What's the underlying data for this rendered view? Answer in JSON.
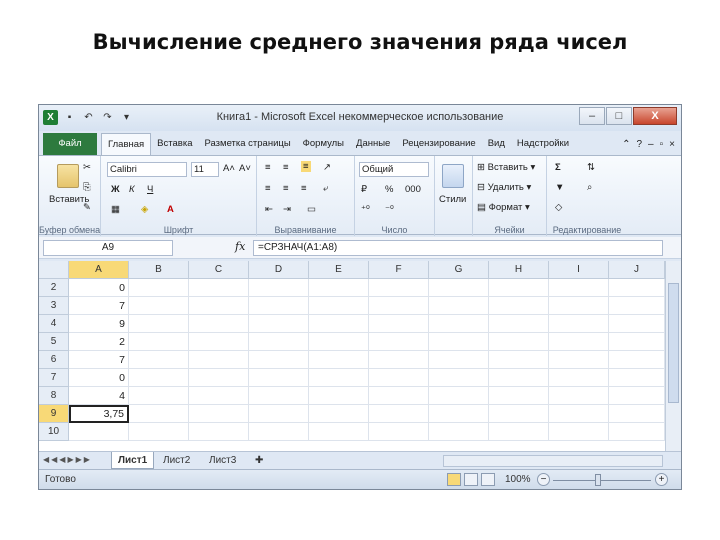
{
  "slide": {
    "title": "Вычисление среднего значения ряда чисел"
  },
  "window": {
    "title": "Книга1 - Microsoft Excel некоммерческое использование",
    "minimize": "–",
    "restore": "□",
    "close": "X"
  },
  "qat": {
    "save": "▪",
    "undo": "↶",
    "redo": "↷",
    "more": "▾"
  },
  "tabs": [
    "Файл",
    "Главная",
    "Вставка",
    "Разметка страницы",
    "Формулы",
    "Данные",
    "Рецензирование",
    "Вид",
    "Надстройки"
  ],
  "ribbon": {
    "clipboard": {
      "paste": "Вставить",
      "label": "Буфер обмена"
    },
    "font": {
      "name": "Calibri",
      "size": "11",
      "bold": "Ж",
      "italic": "К",
      "underline": "Ч",
      "grow": "A˄",
      "shrink": "A˅",
      "label": "Шрифт"
    },
    "alignment": {
      "label": "Выравнивание"
    },
    "number": {
      "format": "Общий",
      "percent": "%",
      "thousands": "000",
      "label": "Число"
    },
    "styles": {
      "button": "Стили",
      "label": ""
    },
    "cells": {
      "insert": "Вставить",
      "delete": "Удалить",
      "format": "Формат",
      "label": "Ячейки"
    },
    "editing": {
      "sum": "Σ",
      "label": "Редактирование"
    }
  },
  "formula_bar": {
    "namebox": "A9",
    "fx": "fx",
    "formula": "=СРЗНАЧ(A1:A8)"
  },
  "grid": {
    "columns": [
      "A",
      "B",
      "C",
      "D",
      "E",
      "F",
      "G",
      "H",
      "I",
      "J"
    ],
    "rows": [
      "2",
      "3",
      "4",
      "5",
      "6",
      "7",
      "8",
      "9",
      "10"
    ],
    "colA_values": [
      "0",
      "7",
      "9",
      "2",
      "7",
      "0",
      "4",
      "3,75",
      ""
    ]
  },
  "sheets": [
    "Лист1",
    "Лист2",
    "Лист3"
  ],
  "status": {
    "text": "Готово",
    "zoom": "100%"
  }
}
